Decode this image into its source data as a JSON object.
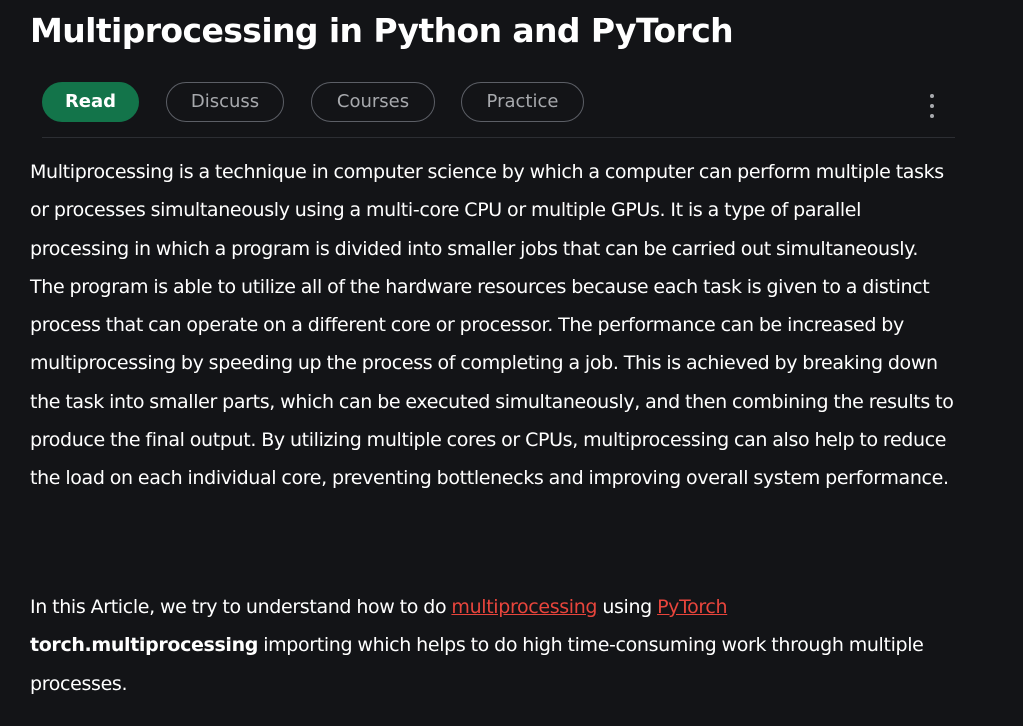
{
  "article": {
    "title": "Multiprocessing in Python and PyTorch",
    "tabs": [
      {
        "label": "Read",
        "active": true
      },
      {
        "label": "Discuss",
        "active": false
      },
      {
        "label": "Courses",
        "active": false
      },
      {
        "label": "Practice",
        "active": false
      }
    ],
    "more_icon": "vertical-ellipsis-icon",
    "paragraph1": "Multiprocessing is a technique in computer science by which a computer can perform multiple tasks or processes simultaneously using a multi-core CPU or multiple GPUs. It is a type of parallel processing in which a program is divided into smaller jobs that can be carried out simultaneously. The program is able to utilize all of the hardware resources because each task is given to a distinct process that can operate on a different core or processor. The performance can be increased by multiprocessing by speeding up the process of completing a job. This is achieved by breaking down the task into smaller parts, which can be executed simultaneously, and then combining the results to produce the final output. By utilizing multiple cores or CPUs, multiprocessing can also help to reduce the load on each individual core, preventing bottlenecks and improving overall system performance.",
    "paragraph2": {
      "intro": "In this Article, we try to understand how to do ",
      "link1": "multiprocessing",
      "middle": " using ",
      "link2": "PyTorch",
      "code_term": "torch.multiprocessing",
      "outro": " importing which helps to do high time-consuming work through multiple processes."
    }
  },
  "colors": {
    "background": "#131417",
    "accent_green": "#13744a",
    "link_red": "#e8453c",
    "tab_border": "#5c5f66",
    "tab_text": "#a7a9ad"
  }
}
